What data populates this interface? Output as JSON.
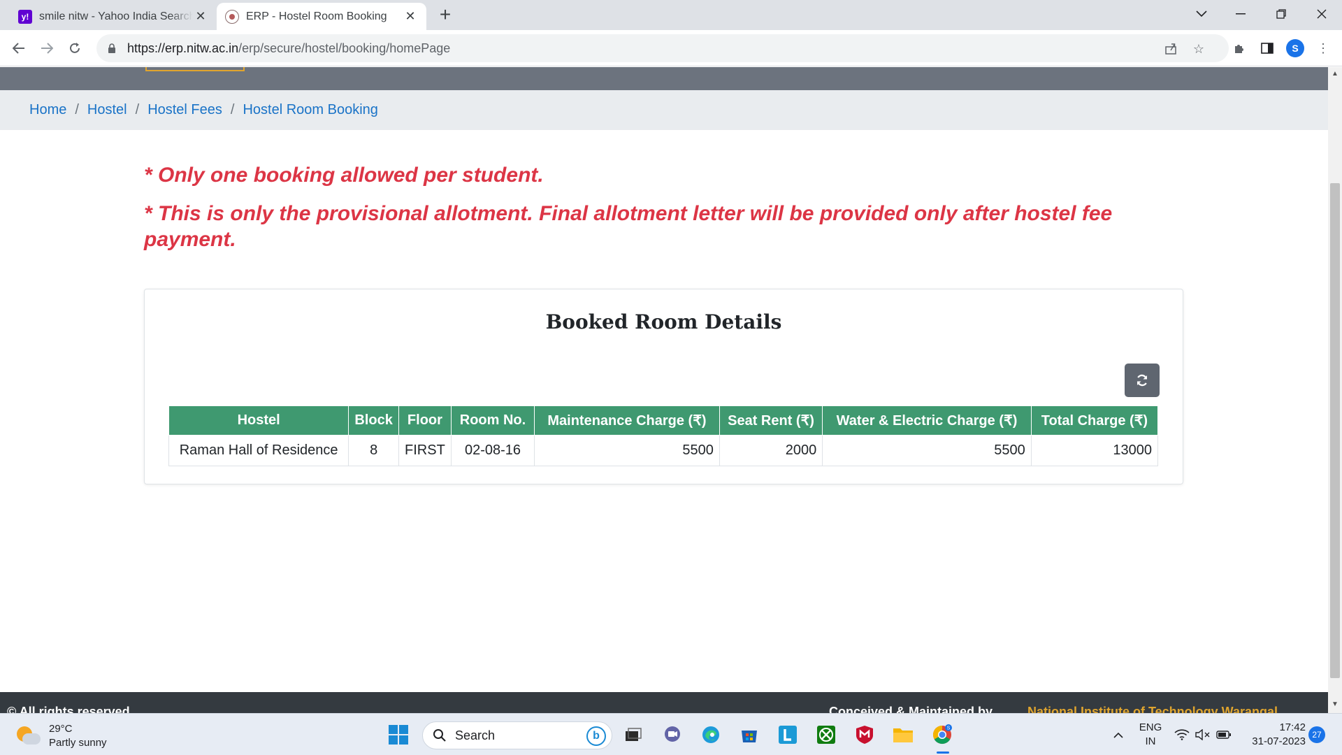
{
  "browser": {
    "tabs": [
      {
        "title": "smile nitw - Yahoo India Search R",
        "favicon": "yahoo-icon",
        "active": false
      },
      {
        "title": "ERP - Hostel Room Booking",
        "favicon": "nitw-logo-icon",
        "active": true
      }
    ],
    "url_host": "https://erp.nitw.ac.in",
    "url_path": "/erp/secure/hostel/booking/homePage",
    "profile_initial": "S"
  },
  "breadcrumb": [
    {
      "label": "Home"
    },
    {
      "label": "Hostel"
    },
    {
      "label": "Hostel Fees"
    },
    {
      "label": "Hostel Room Booking"
    }
  ],
  "notices": [
    "* Only one booking allowed per student.",
    "* This is only the provisional allotment. Final allotment letter will be provided only after hostel fee payment."
  ],
  "booked_room": {
    "title": "Booked Room Details",
    "columns": [
      "Hostel",
      "Block",
      "Floor",
      "Room No.",
      "Maintenance Charge (₹)",
      "Seat Rent (₹)",
      "Water & Electric Charge (₹)",
      "Total Charge (₹)"
    ],
    "rows": [
      {
        "hostel": "Raman Hall of Residence",
        "block": "8",
        "floor": "FIRST",
        "room_no": "02-08-16",
        "maintenance": "5500",
        "seat_rent": "2000",
        "water_electric": "5500",
        "total": "13000"
      }
    ]
  },
  "footer": {
    "left_text": "© All rights reserved",
    "right_text": "Conceived & Maintained by",
    "right_link": "National Institute of Technology Warangal"
  },
  "taskbar": {
    "weather_temp": "29°C",
    "weather_desc": "Partly sunny",
    "search_placeholder": "Search",
    "lang_1": "ENG",
    "lang_2": "IN",
    "time": "17:42",
    "date": "31-07-2023",
    "notifications": "27"
  },
  "colors": {
    "table_header": "#3f9970",
    "notice_red": "#dc3545",
    "link_blue": "#1a73c7",
    "topnav_gray": "#6c737e"
  }
}
